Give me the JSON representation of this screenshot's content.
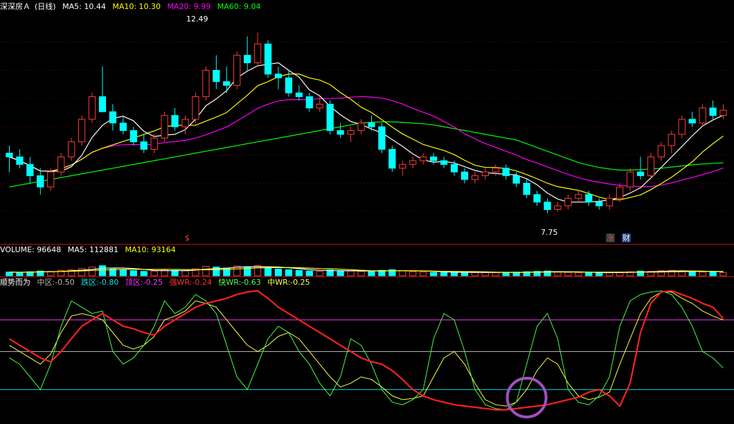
{
  "title": {
    "stock": "深深房Ａ",
    "period": "(日线)",
    "ma": [
      {
        "label": "MA5:",
        "value": "10.44",
        "color": "#ffffff"
      },
      {
        "label": "MA10:",
        "value": "10.30",
        "color": "#ffff00"
      },
      {
        "label": "MA20:",
        "value": "9.99",
        "color": "#ff00ff"
      },
      {
        "label": "MA60:",
        "value": "9.04",
        "color": "#00ff00"
      }
    ]
  },
  "price_annotations": {
    "high": "12.49",
    "low": "7.75",
    "marker_s": "$",
    "marker_zhang": "涨",
    "marker_cai": "财"
  },
  "volume_legend": [
    {
      "label": "VOLUME:",
      "value": "96648",
      "color": "#ffffff"
    },
    {
      "label": "MA5:",
      "value": "112881",
      "color": "#ffffff"
    },
    {
      "label": "MA10:",
      "value": "93164",
      "color": "#ffff00"
    }
  ],
  "indicator_legend": {
    "name": "顺势而为",
    "items": [
      {
        "label": "中区:",
        "value": "-0.50",
        "color": "#bbbbbb"
      },
      {
        "label": "跌区:",
        "value": "-0.80",
        "color": "#00e5e5"
      },
      {
        "label": "顶区:",
        "value": "-0.25",
        "color": "#ff33ff"
      },
      {
        "label": "强WR:",
        "value": "-0.24",
        "color": "#ff3333"
      },
      {
        "label": "快WR:",
        "value": "-0.63",
        "color": "#55ff55"
      },
      {
        "label": "中WR:",
        "value": "-0.25",
        "color": "#ffff55"
      }
    ]
  },
  "colors": {
    "up": "#ff3b3b",
    "down": "#00ffff",
    "ma5": "#ffffff",
    "ma10": "#ffff00",
    "ma20": "#ff00ff",
    "ma60": "#00ff00",
    "grid": "#7a0000",
    "separator": "#b01010",
    "circle": "#a050c0"
  },
  "chart_data": {
    "type": "candlestick",
    "ylim": [
      7.0,
      13.0
    ],
    "candles": [
      [
        9.3,
        9.5,
        8.8,
        9.2
      ],
      [
        9.2,
        9.4,
        8.9,
        9.0
      ],
      [
        9.0,
        9.2,
        8.5,
        8.7
      ],
      [
        8.7,
        8.9,
        8.2,
        8.4
      ],
      [
        8.4,
        8.9,
        8.3,
        8.8
      ],
      [
        8.8,
        9.3,
        8.7,
        9.2
      ],
      [
        9.2,
        9.7,
        9.1,
        9.6
      ],
      [
        9.6,
        10.3,
        9.5,
        10.2
      ],
      [
        10.2,
        10.9,
        10.1,
        10.8
      ],
      [
        10.8,
        11.6,
        10.5,
        10.4
      ],
      [
        10.4,
        10.6,
        9.9,
        10.1
      ],
      [
        10.1,
        10.3,
        9.8,
        9.9
      ],
      [
        9.9,
        10.0,
        9.5,
        9.6
      ],
      [
        9.6,
        9.8,
        9.3,
        9.4
      ],
      [
        9.4,
        9.8,
        9.3,
        9.7
      ],
      [
        9.7,
        10.4,
        9.6,
        10.3
      ],
      [
        10.3,
        10.5,
        9.9,
        10.0
      ],
      [
        10.0,
        10.3,
        9.8,
        10.2
      ],
      [
        10.2,
        10.9,
        10.1,
        10.8
      ],
      [
        10.8,
        11.6,
        10.7,
        11.5
      ],
      [
        11.5,
        11.9,
        11.0,
        11.2
      ],
      [
        11.2,
        11.6,
        10.9,
        11.1
      ],
      [
        11.1,
        12.0,
        11.0,
        11.9
      ],
      [
        11.9,
        12.4,
        11.5,
        11.7
      ],
      [
        11.7,
        12.5,
        11.6,
        12.2
      ],
      [
        12.2,
        12.3,
        11.3,
        11.4
      ],
      [
        11.4,
        11.6,
        11.0,
        11.3
      ],
      [
        11.3,
        11.5,
        10.8,
        10.9
      ],
      [
        10.9,
        11.1,
        10.7,
        10.8
      ],
      [
        10.8,
        10.9,
        10.4,
        10.5
      ],
      [
        10.5,
        10.8,
        10.4,
        10.6
      ],
      [
        10.6,
        10.7,
        9.8,
        9.9
      ],
      [
        9.9,
        10.1,
        9.7,
        9.8
      ],
      [
        9.8,
        10.0,
        9.6,
        9.9
      ],
      [
        9.9,
        10.2,
        9.8,
        10.1
      ],
      [
        10.1,
        10.3,
        9.9,
        10.0
      ],
      [
        10.0,
        10.1,
        9.3,
        9.4
      ],
      [
        9.4,
        9.5,
        8.8,
        8.9
      ],
      [
        8.9,
        9.1,
        8.7,
        9.0
      ],
      [
        9.0,
        9.2,
        8.9,
        9.1
      ],
      [
        9.1,
        9.3,
        9.0,
        9.2
      ],
      [
        9.2,
        9.3,
        9.0,
        9.1
      ],
      [
        9.1,
        9.2,
        8.9,
        9.0
      ],
      [
        9.0,
        9.1,
        8.7,
        8.8
      ],
      [
        8.8,
        8.9,
        8.5,
        8.6
      ],
      [
        8.6,
        8.8,
        8.5,
        8.7
      ],
      [
        8.7,
        8.9,
        8.6,
        8.8
      ],
      [
        8.8,
        9.0,
        8.7,
        8.9
      ],
      [
        8.9,
        9.0,
        8.6,
        8.7
      ],
      [
        8.7,
        8.8,
        8.4,
        8.5
      ],
      [
        8.5,
        8.6,
        8.1,
        8.2
      ],
      [
        8.2,
        8.3,
        7.9,
        8.0
      ],
      [
        8.0,
        8.1,
        7.7,
        7.8
      ],
      [
        7.8,
        8.0,
        7.75,
        7.9
      ],
      [
        7.9,
        8.2,
        7.8,
        8.1
      ],
      [
        8.1,
        8.3,
        8.0,
        8.2
      ],
      [
        8.2,
        8.3,
        7.9,
        8.0
      ],
      [
        8.0,
        8.1,
        7.8,
        7.9
      ],
      [
        7.9,
        8.2,
        7.8,
        8.1
      ],
      [
        8.1,
        8.5,
        8.0,
        8.4
      ],
      [
        8.4,
        8.9,
        8.3,
        8.8
      ],
      [
        8.8,
        9.2,
        8.6,
        8.7
      ],
      [
        8.7,
        9.3,
        8.6,
        9.2
      ],
      [
        9.2,
        9.6,
        9.1,
        9.5
      ],
      [
        9.5,
        9.9,
        9.3,
        9.8
      ],
      [
        9.8,
        10.3,
        9.7,
        10.2
      ],
      [
        10.2,
        10.4,
        10.0,
        10.1
      ],
      [
        10.1,
        10.6,
        10.0,
        10.5
      ],
      [
        10.5,
        10.7,
        10.2,
        10.3
      ],
      [
        10.3,
        10.6,
        10.2,
        10.44
      ]
    ],
    "ma60": [
      8.4,
      8.45,
      8.5,
      8.55,
      8.6,
      8.65,
      8.7,
      8.75,
      8.8,
      8.85,
      8.9,
      8.95,
      9.0,
      9.05,
      9.1,
      9.15,
      9.2,
      9.25,
      9.3,
      9.35,
      9.4,
      9.45,
      9.5,
      9.55,
      9.6,
      9.65,
      9.7,
      9.75,
      9.8,
      9.85,
      9.9,
      9.95,
      10.0,
      10.05,
      10.1,
      10.12,
      10.13,
      10.13,
      10.12,
      10.1,
      10.08,
      10.05,
      10.0,
      9.95,
      9.9,
      9.85,
      9.8,
      9.75,
      9.7,
      9.65,
      9.55,
      9.45,
      9.35,
      9.25,
      9.15,
      9.05,
      8.98,
      8.92,
      8.88,
      8.85,
      8.85,
      8.86,
      8.88,
      8.9,
      8.93,
      8.96,
      8.99,
      9.01,
      9.03,
      9.04
    ],
    "volume": {
      "ylim": [
        0,
        600000
      ],
      "values": [
        110000,
        95000,
        120000,
        140000,
        130000,
        160000,
        180000,
        220000,
        260000,
        300000,
        200000,
        170000,
        150000,
        130000,
        140000,
        180000,
        160000,
        150000,
        210000,
        280000,
        260000,
        230000,
        290000,
        270000,
        300000,
        240000,
        200000,
        180000,
        160000,
        140000,
        130000,
        170000,
        150000,
        140000,
        130000,
        120000,
        160000,
        180000,
        150000,
        120000,
        110000,
        100000,
        95000,
        105000,
        110000,
        100000,
        95000,
        90000,
        100000,
        110000,
        120000,
        130000,
        140000,
        110000,
        100000,
        95000,
        90000,
        85000,
        100000,
        110000,
        120000,
        140000,
        130000,
        150000,
        160000,
        140000,
        120000,
        110000,
        115000,
        96648
      ]
    },
    "indicator": {
      "ylim": [
        -1.05,
        0.0
      ],
      "levels": [
        {
          "name": "顶区",
          "value": -0.25,
          "color": "#ff33ff"
        },
        {
          "name": "中区",
          "value": -0.5,
          "color": "#bbbbbb"
        },
        {
          "name": "跌区",
          "value": -0.8,
          "color": "#00e5e5"
        }
      ],
      "series": [
        {
          "name": "强WR",
          "color": "#ff2020",
          "width": 2.2,
          "values": [
            -0.4,
            -0.45,
            -0.5,
            -0.55,
            -0.58,
            -0.5,
            -0.4,
            -0.3,
            -0.25,
            -0.2,
            -0.25,
            -0.3,
            -0.32,
            -0.35,
            -0.37,
            -0.3,
            -0.25,
            -0.2,
            -0.15,
            -0.12,
            -0.1,
            -0.08,
            -0.05,
            -0.03,
            -0.02,
            -0.08,
            -0.15,
            -0.2,
            -0.25,
            -0.3,
            -0.35,
            -0.4,
            -0.45,
            -0.5,
            -0.55,
            -0.58,
            -0.6,
            -0.65,
            -0.72,
            -0.8,
            -0.85,
            -0.88,
            -0.9,
            -0.92,
            -0.93,
            -0.94,
            -0.95,
            -0.96,
            -0.96,
            -0.95,
            -0.94,
            -0.93,
            -0.92,
            -0.9,
            -0.88,
            -0.86,
            -0.82,
            -0.8,
            -0.85,
            -0.93,
            -0.75,
            -0.35,
            -0.12,
            -0.03,
            -0.02,
            -0.05,
            -0.08,
            -0.12,
            -0.15,
            -0.24
          ]
        },
        {
          "name": "快WR",
          "color": "#44ff44",
          "width": 1.0,
          "values": [
            -0.55,
            -0.6,
            -0.7,
            -0.8,
            -0.6,
            -0.3,
            -0.1,
            -0.15,
            -0.2,
            -0.18,
            -0.5,
            -0.6,
            -0.55,
            -0.45,
            -0.3,
            -0.1,
            -0.2,
            -0.15,
            -0.05,
            -0.1,
            -0.2,
            -0.45,
            -0.7,
            -0.8,
            -0.6,
            -0.4,
            -0.3,
            -0.35,
            -0.5,
            -0.6,
            -0.75,
            -0.85,
            -0.7,
            -0.4,
            -0.45,
            -0.6,
            -0.8,
            -0.9,
            -0.92,
            -0.88,
            -0.8,
            -0.4,
            -0.2,
            -0.25,
            -0.5,
            -0.8,
            -0.92,
            -0.95,
            -0.96,
            -0.9,
            -0.6,
            -0.3,
            -0.2,
            -0.4,
            -0.8,
            -0.9,
            -0.92,
            -0.85,
            -0.7,
            -0.3,
            -0.1,
            -0.05,
            -0.03,
            -0.02,
            -0.05,
            -0.15,
            -0.3,
            -0.5,
            -0.55,
            -0.63
          ]
        },
        {
          "name": "中WR",
          "color": "#ffff40",
          "width": 1.0,
          "values": [
            -0.45,
            -0.5,
            -0.55,
            -0.6,
            -0.52,
            -0.35,
            -0.22,
            -0.2,
            -0.22,
            -0.25,
            -0.35,
            -0.45,
            -0.48,
            -0.45,
            -0.38,
            -0.25,
            -0.22,
            -0.18,
            -0.1,
            -0.12,
            -0.15,
            -0.25,
            -0.35,
            -0.45,
            -0.5,
            -0.45,
            -0.38,
            -0.35,
            -0.4,
            -0.5,
            -0.6,
            -0.7,
            -0.78,
            -0.75,
            -0.7,
            -0.72,
            -0.78,
            -0.85,
            -0.88,
            -0.87,
            -0.85,
            -0.7,
            -0.55,
            -0.5,
            -0.6,
            -0.75,
            -0.88,
            -0.92,
            -0.93,
            -0.9,
            -0.8,
            -0.65,
            -0.55,
            -0.6,
            -0.75,
            -0.85,
            -0.88,
            -0.86,
            -0.82,
            -0.6,
            -0.4,
            -0.2,
            -0.08,
            -0.03,
            -0.03,
            -0.08,
            -0.12,
            -0.18,
            -0.22,
            -0.25
          ]
        }
      ]
    }
  }
}
